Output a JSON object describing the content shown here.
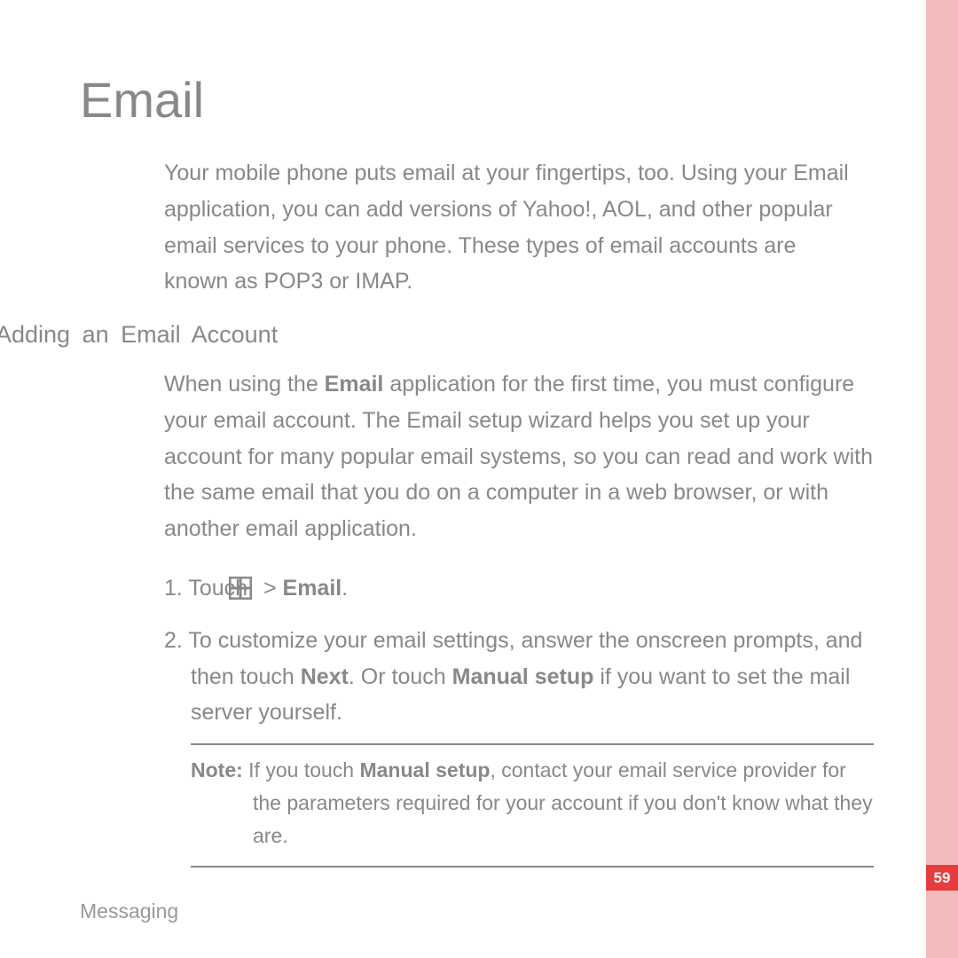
{
  "heading": "Email",
  "intro": "Your mobile phone puts email at your fingertips, too. Using your Email application, you can add versions of Yahoo!, AOL, and other popular email services to your phone. These types of email accounts are known as POP3 or IMAP.",
  "subheading": "Adding an Email Account",
  "body": "When using the <b>Email</b> application for the first time, you must configure your email account. The Email setup wizard helps you set up your account for many popular email systems, so you can read and work with the same email that you do on a computer in a web browser, or with another email application.",
  "steps": {
    "s1_prefix": "1. Touch ",
    "s1_suffix": " > <b>Email</b>.",
    "s2": "2. To customize your email settings, answer the onscreen prompts, and then touch <b>Next</b>. Or touch <b>Manual setup</b> if you want to set the mail server yourself."
  },
  "note": "<b>Note:</b>  If you touch <b>Manual setup</b>, contact your email service provider for the parameters required for your account if you don't know what they are.",
  "footer": "Messaging",
  "page_number": "59"
}
